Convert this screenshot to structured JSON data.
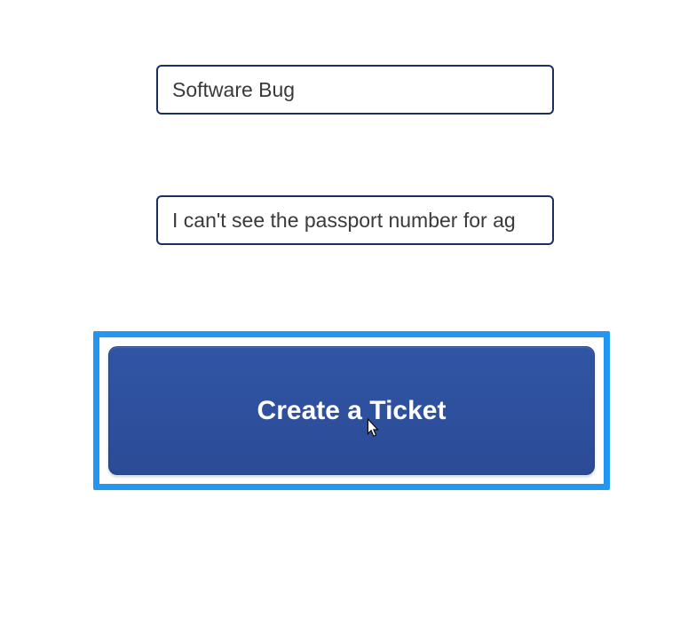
{
  "form": {
    "subject_value": "Software Bug",
    "description_value": "I can't see the passport number for ag",
    "submit_label": "Create a Ticket"
  }
}
